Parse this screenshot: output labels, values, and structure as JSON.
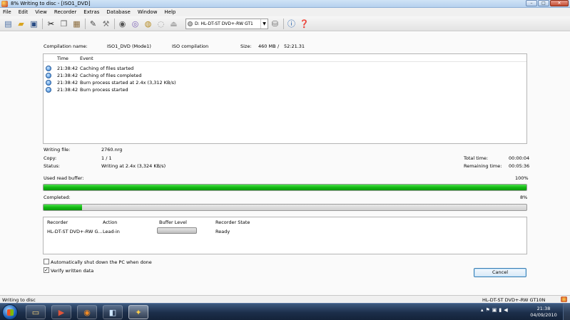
{
  "window": {
    "title": "8% Writing to disc - [ISO1_DVD]",
    "controls": {
      "minimize": "–",
      "maximize": "□",
      "close": "✕"
    }
  },
  "menu": [
    "File",
    "Edit",
    "View",
    "Recorder",
    "Extras",
    "Database",
    "Window",
    "Help"
  ],
  "toolbar": {
    "drive": "D: HL-DT-ST DVD+-RW GT1",
    "icons": [
      "new-icon",
      "open-icon",
      "save-icon",
      "cut-icon",
      "copy-icon",
      "paste-icon",
      "edit-icon",
      "tools-icon",
      "burn-icon",
      "copy-disc-icon",
      "disc-info-icon",
      "erase-icon",
      "eject-icon",
      "drive-icon",
      "info-icon",
      "help-icon"
    ]
  },
  "compilation": {
    "name_label": "Compilation name:",
    "name": "ISO1_DVD (Mode1)",
    "type": "ISO compilation",
    "size_label": "Size:",
    "size": "460 MB",
    "separator": "/",
    "duration": "52:21.31"
  },
  "events": {
    "headers": {
      "time": "Time",
      "event": "Event"
    },
    "rows": [
      {
        "time": "21:38:42",
        "event": "Caching of files started"
      },
      {
        "time": "21:38:42",
        "event": "Caching of files completed"
      },
      {
        "time": "21:38:42",
        "event": "Burn process started at 2.4x (3,312 KB/s)"
      },
      {
        "time": "21:38:42",
        "event": "Burn process started"
      }
    ]
  },
  "status": {
    "writing_file_label": "Writing file:",
    "writing_file": "2760.nrg",
    "copy_label": "Copy:",
    "copy": "1 / 1",
    "status_label": "Status:",
    "status": "Writing at 2.4x (3,324 KB/s)",
    "total_time_label": "Total time:",
    "total_time": "00:00:04",
    "remaining_time_label": "Remaining time:",
    "remaining_time": "00:05:36"
  },
  "buffer": {
    "label": "Used read buffer:",
    "value_text": "100%",
    "fraction": 1.0
  },
  "completed": {
    "label": "Completed:",
    "value_text": "8%",
    "fraction": 0.08
  },
  "recorder_table": {
    "headers": {
      "recorder": "Recorder",
      "action": "Action",
      "buffer": "Buffer Level",
      "state": "Recorder State"
    },
    "rows": [
      {
        "recorder": "HL-DT-ST DVD+-RW G...",
        "action": "Lead-in",
        "buffer_fraction": 0.0,
        "state": "Ready"
      }
    ]
  },
  "options": {
    "shutdown": {
      "label": "Automatically shut down the PC when done",
      "checked": false
    },
    "verify": {
      "label": "Verify written data",
      "checked": true
    }
  },
  "buttons": {
    "cancel": "Cancel"
  },
  "statusbar": {
    "left": "Writing to disc",
    "right": "HL-DT-ST DVD+-RW GT10N"
  },
  "taskbar": {
    "time": "21:38",
    "date": "04/09/2010",
    "apps": [
      "explorer-icon",
      "media-icon",
      "firefox-icon",
      "app-icon",
      "nero-burn-icon"
    ]
  },
  "colors": {
    "progress_green": "#13b813",
    "titlebar": "#b6d1ee",
    "taskbar": "#1c2e4a"
  }
}
